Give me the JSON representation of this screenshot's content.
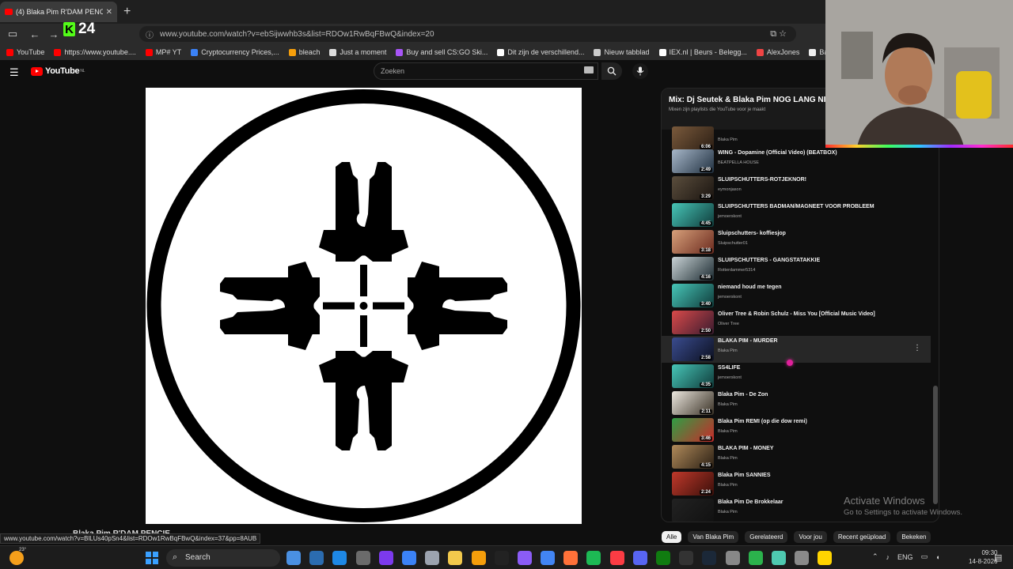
{
  "browser": {
    "tab_title": "(4) Blaka Pim R'DAM PENCI",
    "url": "www.youtube.com/watch?v=ebSijwwhb3s&list=RDOw1RwBqFBwQ&index=20",
    "kick_count": "24",
    "status_url": "www.youtube.com/watch?v=BlLUs40pSn4&list=RDOw1RwBqFBwQ&index=37&pp=8AUB",
    "bookmarks": [
      {
        "label": "YouTube",
        "color": "#ff0000"
      },
      {
        "label": "https://www.youtube....",
        "color": "#ff0000"
      },
      {
        "label": "MP# YT",
        "color": "#ff0000"
      },
      {
        "label": "Cryptocurrency Prices,...",
        "color": "#3b82f6"
      },
      {
        "label": "bleach",
        "color": "#f59e0b"
      },
      {
        "label": "Just a moment",
        "color": "#dddddd"
      },
      {
        "label": "Buy and sell CS:GO Ski...",
        "color": "#a855f7"
      },
      {
        "label": "Dit zijn de verschillend...",
        "color": "#ffffff"
      },
      {
        "label": "Nieuw tabblad",
        "color": "#cccccc"
      },
      {
        "label": "IEX.nl | Beurs - Belegg...",
        "color": "#ffffff"
      },
      {
        "label": "AlexJones",
        "color": "#ef4444"
      },
      {
        "label": "Banned.Video",
        "color": "#eeeeee"
      },
      {
        "label": "Niburu.co :: Onthulle...",
        "color": "#f59e0b"
      }
    ]
  },
  "youtube": {
    "logo_text": "YouTube",
    "logo_region": "NL",
    "search_placeholder": "Zoeken",
    "below_video_title": "Blaka Pim R'DAM PENCIE"
  },
  "playlist": {
    "title": "Mix: Dj Seutek & Blaka Pim NOG LANG NI",
    "subtitle": "Mixen zijn playlists die YouTube voor je maakt",
    "items": [
      {
        "title": "",
        "channel": "Blaka Pim",
        "duration": "6:06",
        "thumb": [
          "#7a5a3c",
          "#2b1e14"
        ]
      },
      {
        "title": "WING - Dopamine (Official Video) (BEATBOX)",
        "channel": "BEATPELLA HOUSE",
        "duration": "2:49",
        "thumb": [
          "#a7b7c9",
          "#203040"
        ]
      },
      {
        "title": "SLUIPSCHUTTERS-ROTJEKNOR!",
        "channel": "eymonjason",
        "duration": "3:29",
        "thumb": [
          "#5b4e3d",
          "#1a1410"
        ]
      },
      {
        "title": "SLUIPSCHUTTERS BADMAN/MAGNEET VOOR PROBLEEM",
        "channel": "jemoerskont",
        "duration": "4:45",
        "thumb": [
          "#47c6b8",
          "#0f3b3a"
        ]
      },
      {
        "title": "Sluipschutters- koffiesjop",
        "channel": "Sluipschutter01",
        "duration": "3:18",
        "thumb": [
          "#d7a07a",
          "#6b2a1e"
        ]
      },
      {
        "title": "SLUIPSCHUTTERS - GANGSTATAKKIE",
        "channel": "Rotterdammer5314",
        "duration": "4:16",
        "thumb": [
          "#c9d2d6",
          "#1c2b31"
        ]
      },
      {
        "title": "niemand houd me tegen",
        "channel": "jemoerskont",
        "duration": "3:40",
        "thumb": [
          "#47c6b8",
          "#0f3b3a"
        ]
      },
      {
        "title": "Oliver Tree & Robin Schulz - Miss You [Official Music Video]",
        "channel": "Oliver Tree",
        "duration": "2:50",
        "thumb": [
          "#d94a4a",
          "#3a1b2f"
        ]
      },
      {
        "title": "BLAKA PIM - MURDER",
        "channel": "Blaka Pim",
        "duration": "2:58",
        "thumb": [
          "#3a4c8f",
          "#0c1020"
        ]
      },
      {
        "title": "SS4LIFE",
        "channel": "jemoerskont",
        "duration": "4:35",
        "thumb": [
          "#47c6b8",
          "#0f3b3a"
        ]
      },
      {
        "title": "Blaka Pim - De Zon",
        "channel": "Blaka Pim",
        "duration": "2:11",
        "thumb": [
          "#ece7df",
          "#3a3226"
        ]
      },
      {
        "title": "Blaka Pim REMI (op die dow remi)",
        "channel": "Blaka Pim",
        "duration": "3:46",
        "thumb": [
          "#2f9e44",
          "#c92a2a"
        ]
      },
      {
        "title": "BLAKA PIM - MONEY",
        "channel": "Blaka Pim",
        "duration": "4:15",
        "thumb": [
          "#b08a5a",
          "#2a1f14"
        ]
      },
      {
        "title": "Blaka Pim SANNIES",
        "channel": "Blaka Pim",
        "duration": "2:24",
        "thumb": [
          "#c0392b",
          "#3a0f0a"
        ]
      },
      {
        "title": "Blaka Pim De Brokkelaar",
        "channel": "Blaka Pim",
        "duration": "",
        "thumb": [
          "#222222",
          "#111111"
        ]
      }
    ]
  },
  "chips": [
    "Alle",
    "Van Blaka Pim",
    "Gerelateerd",
    "Voor jou",
    "Recent geüpload",
    "Bekeken"
  ],
  "watermark": {
    "line1": "Activate Windows",
    "line2": "Go to Settings to activate Windows."
  },
  "taskbar": {
    "temperature": "23°",
    "search_label": "Search",
    "language": "ENG",
    "time": "09:30",
    "date": "14-8-2026",
    "apps": [
      "#4a90e2",
      "#2b6cb0",
      "#1e88e5",
      "#6b6b6b",
      "#7c3aed",
      "#3b82f6",
      "#9ca3af",
      "#f2c94c",
      "#f59e0b",
      "#222222",
      "#8b5cf6",
      "#4285f4",
      "#ff7139",
      "#1db954",
      "#fc3c44",
      "#5865f2",
      "#107c10",
      "#333333",
      "#1b2838",
      "#888888",
      "#2bb24c",
      "#4ec9b0",
      "#8a8a8a",
      "#ffd400"
    ]
  }
}
